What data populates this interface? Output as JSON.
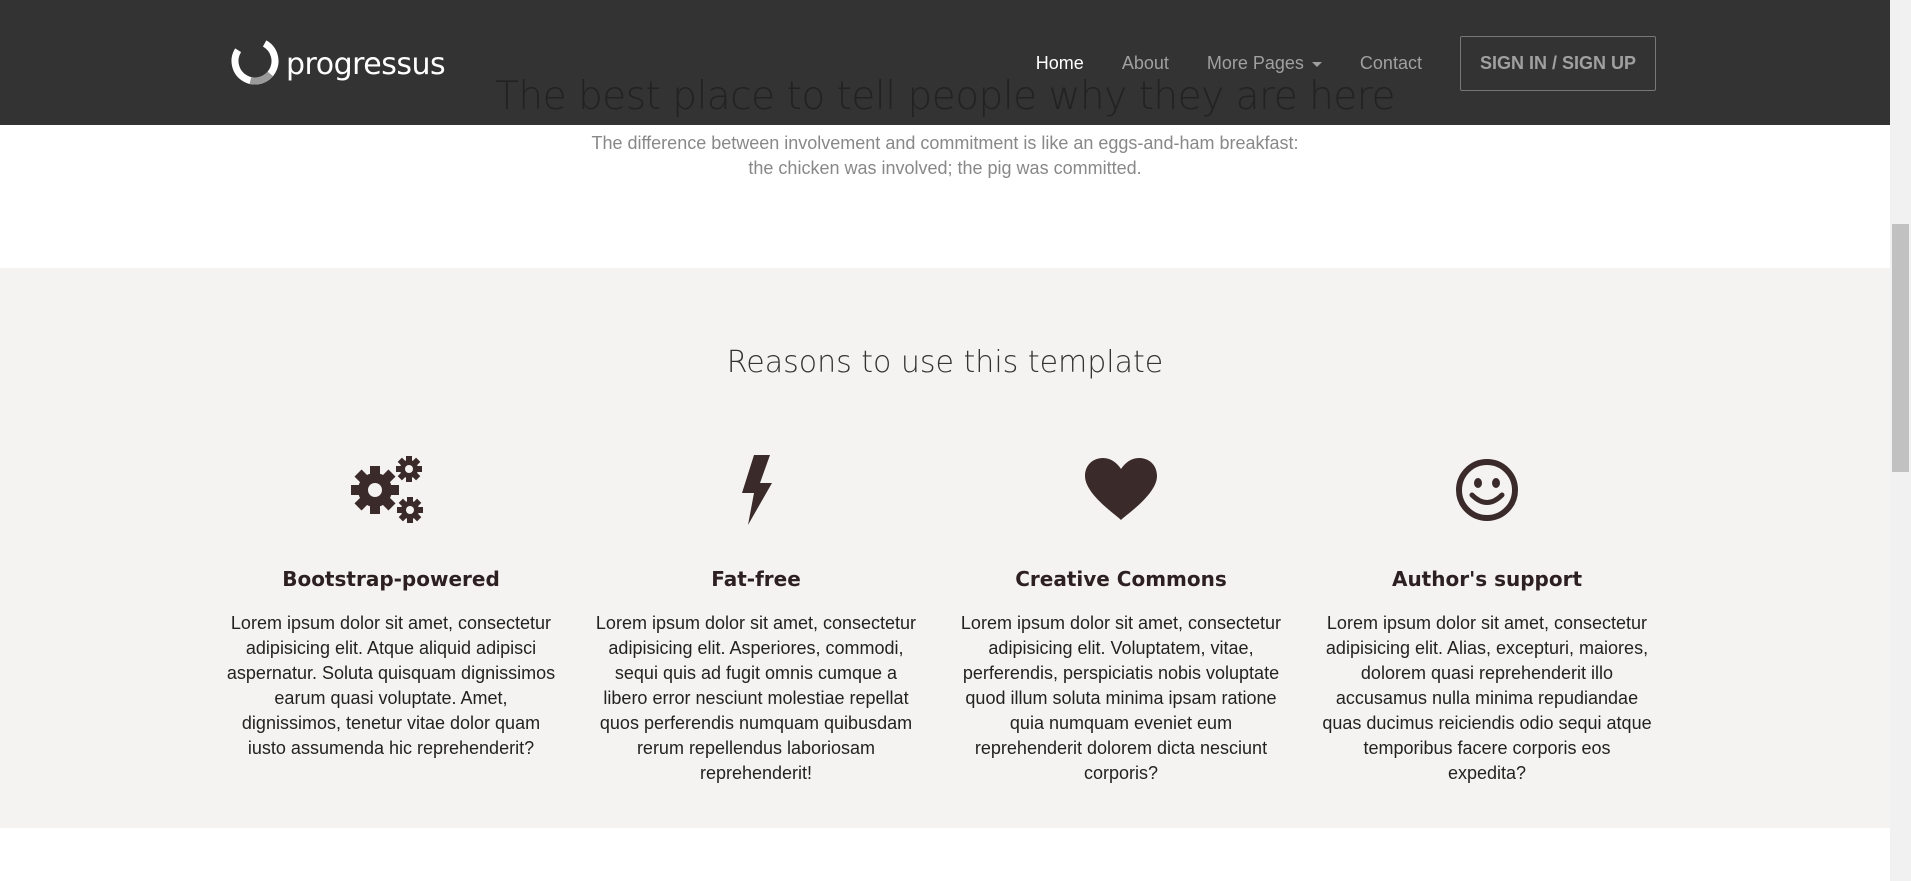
{
  "navbar": {
    "brand": "progressus",
    "items": [
      {
        "label": "Home",
        "active": true
      },
      {
        "label": "About"
      },
      {
        "label": "More Pages"
      },
      {
        "label": "Contact"
      }
    ],
    "signin_label": "SIGN IN / SIGN UP"
  },
  "intro": {
    "title": "The best place to tell people why they are here",
    "lead_line1": "The difference between involvement and commitment is like an eggs-and-ham breakfast:",
    "lead_line2": "the chicken was involved; the pig was committed."
  },
  "reasons": {
    "title": "Reasons to use this template",
    "features": [
      {
        "icon": "gears-icon",
        "title": "Bootstrap-powered",
        "text": "Lorem ipsum dolor sit amet, consectetur adipisicing elit. Atque aliquid adipisci aspernatur. Soluta quisquam dignissimos earum quasi voluptate. Amet, dignissimos, tenetur vitae dolor quam iusto assumenda hic reprehenderit?"
      },
      {
        "icon": "flash-icon",
        "title": "Fat-free",
        "text": "Lorem ipsum dolor sit amet, consectetur adipisicing elit. Asperiores, commodi, sequi quis ad fugit omnis cumque a libero error nesciunt molestiae repellat quos perferendis numquam quibusdam rerum repellendus laboriosam reprehenderit!"
      },
      {
        "icon": "heart-icon",
        "title": "Creative Commons",
        "text": "Lorem ipsum dolor sit amet, consectetur adipisicing elit. Voluptatem, vitae, perferendis, perspiciatis nobis voluptate quod illum soluta minima ipsam ratione quia numquam eveniet eum reprehenderit dolorem dicta nesciunt corporis?"
      },
      {
        "icon": "smile-icon",
        "title": "Author's support",
        "text": "Lorem ipsum dolor sit amet, consectetur adipisicing elit. Alias, excepturi, maiores, dolorem quasi reprehenderit illo accusamus nulla minima repudiandae quas ducimus reiciendis odio sequi atque temporibus facere corporis eos expedita?"
      }
    ]
  },
  "colors": {
    "navbar_bg": "#333333",
    "section_bg": "#f5f3f1",
    "icon_color": "#3a2a2a"
  }
}
